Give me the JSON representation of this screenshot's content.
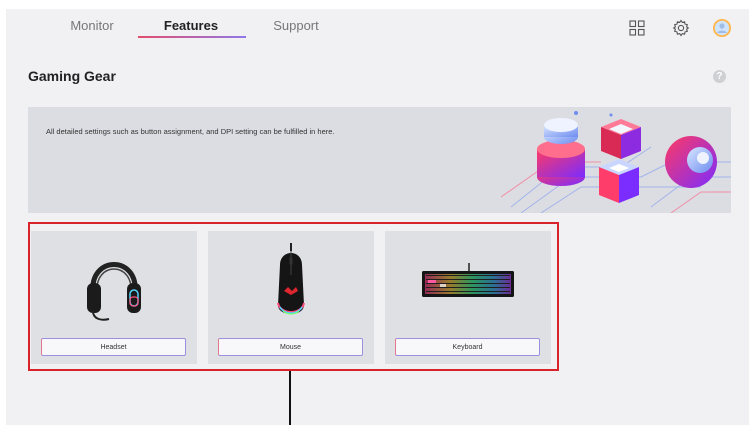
{
  "nav": {
    "tabs": [
      {
        "label": "Monitor",
        "active": false
      },
      {
        "label": "Features",
        "active": true
      },
      {
        "label": "Support",
        "active": false
      }
    ],
    "icons": [
      "grid-icon",
      "gear-icon",
      "profile-icon"
    ]
  },
  "header": {
    "title": "Gaming Gear",
    "help_glyph": "?"
  },
  "banner": {
    "text": "All detailed settings such as button assignment, and DPI setting can be fulfilled in here."
  },
  "devices": [
    {
      "label": "Headset",
      "icon": "headset-icon"
    },
    {
      "label": "Mouse",
      "icon": "mouse-icon"
    },
    {
      "label": "Keyboard",
      "icon": "keyboard-icon"
    }
  ],
  "colors": {
    "accent_red": "#d8232a",
    "tab_gradient_start": "#e24d6d",
    "tab_gradient_end": "#8f78e8",
    "card_bg": "#dfe0e4",
    "app_bg": "#f1f1f3"
  }
}
